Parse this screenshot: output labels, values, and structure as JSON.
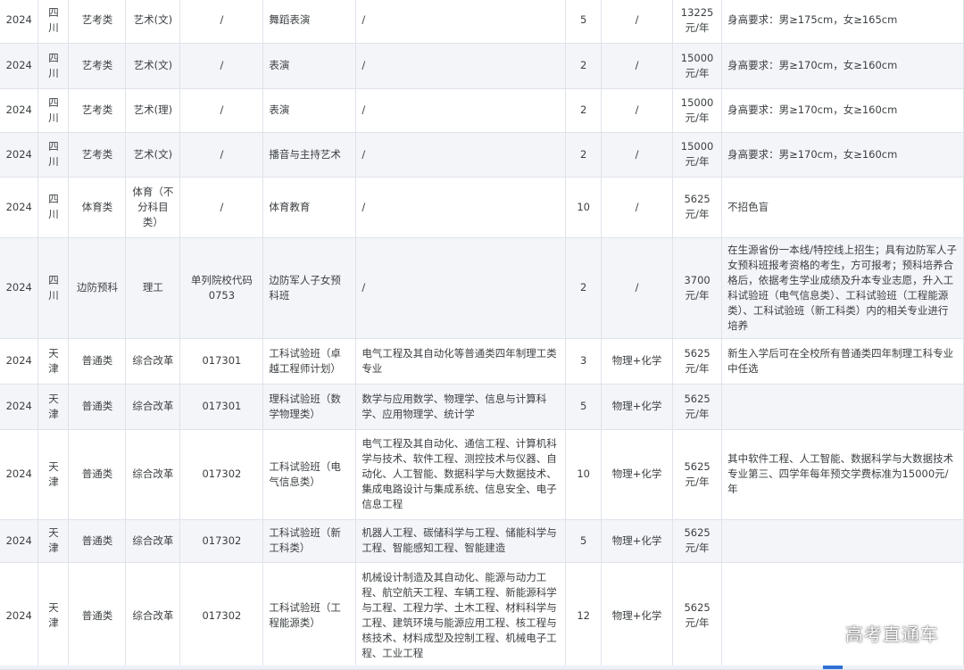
{
  "watermark": "高考直通车",
  "rows": [
    {
      "year": "2024",
      "province": "四川",
      "batch": "艺考类",
      "subject": "艺术(文)",
      "code": "/",
      "major": "舞蹈表演",
      "includes": "/",
      "plan": "5",
      "requirement": "/",
      "tuition": "13225元/年",
      "remark": "身高要求：男≥175cm，女≥165cm"
    },
    {
      "year": "2024",
      "province": "四川",
      "batch": "艺考类",
      "subject": "艺术(文)",
      "code": "/",
      "major": "表演",
      "includes": "/",
      "plan": "2",
      "requirement": "/",
      "tuition": "15000元/年",
      "remark": "身高要求：男≥170cm，女≥160cm"
    },
    {
      "year": "2024",
      "province": "四川",
      "batch": "艺考类",
      "subject": "艺术(理)",
      "code": "/",
      "major": "表演",
      "includes": "/",
      "plan": "2",
      "requirement": "/",
      "tuition": "15000元/年",
      "remark": "身高要求：男≥170cm，女≥160cm"
    },
    {
      "year": "2024",
      "province": "四川",
      "batch": "艺考类",
      "subject": "艺术(文)",
      "code": "/",
      "major": "播音与主持艺术",
      "includes": "/",
      "plan": "2",
      "requirement": "/",
      "tuition": "15000元/年",
      "remark": "身高要求：男≥170cm，女≥160cm"
    },
    {
      "year": "2024",
      "province": "四川",
      "batch": "体育类",
      "subject": "体育（不分科目类）",
      "code": "/",
      "major": "体育教育",
      "includes": "/",
      "plan": "10",
      "requirement": "/",
      "tuition": "5625元/年",
      "remark": "不招色盲"
    },
    {
      "year": "2024",
      "province": "四川",
      "batch": "边防预科",
      "subject": "理工",
      "code": "单列院校代码0753",
      "major": "边防军人子女预科班",
      "includes": "/",
      "plan": "2",
      "requirement": "/",
      "tuition": "3700元/年",
      "remark": "在生源省份一本线/特控线上招生；具有边防军人子女预科班报考资格的考生，方可报考；预科培养合格后，依据考生学业成绩及升本专业志愿，升入工科试验班（电气信息类）、工科试验班（工程能源类）、工科试验班（新工科类）内的相关专业进行培养"
    },
    {
      "year": "2024",
      "province": "天津",
      "batch": "普通类",
      "subject": "综合改革",
      "code": "017301",
      "major": "工科试验班（卓越工程师计划）",
      "includes": "电气工程及其自动化等普通类四年制理工类专业",
      "plan": "3",
      "requirement": "物理+化学",
      "tuition": "5625元/年",
      "remark": "新生入学后可在全校所有普通类四年制理工科专业中任选"
    },
    {
      "year": "2024",
      "province": "天津",
      "batch": "普通类",
      "subject": "综合改革",
      "code": "017301",
      "major": "理科试验班（数学物理类）",
      "includes": "数学与应用数学、物理学、信息与计算科学、应用物理学、统计学",
      "plan": "5",
      "requirement": "物理+化学",
      "tuition": "5625元/年",
      "remark": ""
    },
    {
      "year": "2024",
      "province": "天津",
      "batch": "普通类",
      "subject": "综合改革",
      "code": "017302",
      "major": "工科试验班（电气信息类）",
      "includes": "电气工程及其自动化、通信工程、计算机科学与技术、软件工程、测控技术与仪器、自动化、人工智能、数据科学与大数据技术、集成电路设计与集成系统、信息安全、电子信息工程",
      "plan": "10",
      "requirement": "物理+化学",
      "tuition": "5625元/年",
      "remark": "其中软件工程、人工智能、数据科学与大数据技术专业第三、四学年每年预交学费标准为15000元/年"
    },
    {
      "year": "2024",
      "province": "天津",
      "batch": "普通类",
      "subject": "综合改革",
      "code": "017302",
      "major": "工科试验班（新工科类）",
      "includes": "机器人工程、碳储科学与工程、储能科学与工程、智能感知工程、智能建造",
      "plan": "5",
      "requirement": "物理+化学",
      "tuition": "5625元/年",
      "remark": ""
    },
    {
      "year": "2024",
      "province": "天津",
      "batch": "普通类",
      "subject": "综合改革",
      "code": "017302",
      "major": "工科试验班（工程能源类）",
      "includes": "机械设计制造及其自动化、能源与动力工程、航空航天工程、车辆工程、新能源科学与工程、工程力学、土木工程、材料科学与工程、建筑环境与能源应用工程、核工程与核技术、材料成型及控制工程、机械电子工程、工业工程",
      "plan": "12",
      "requirement": "物理+化学",
      "tuition": "5625元/年",
      "remark": ""
    }
  ]
}
